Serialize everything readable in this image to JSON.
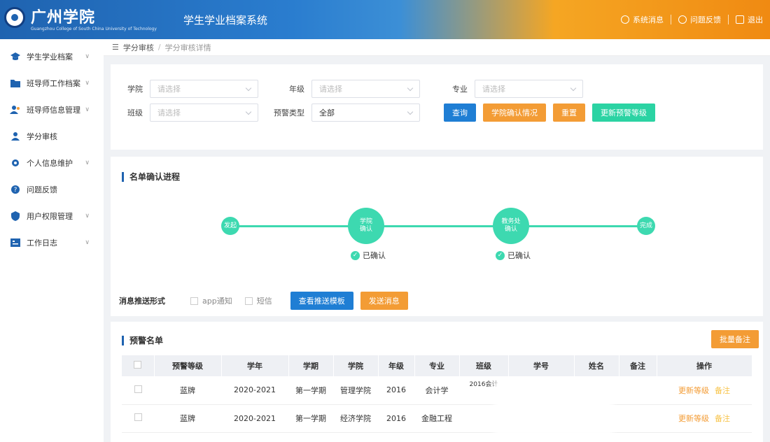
{
  "header": {
    "school_name": "广州学院",
    "school_name_en": "Guangzhou College of South China University of Technology",
    "system_title": "学生学业档案系统",
    "actions": [
      {
        "label": "系统消息",
        "icon": "bell-icon"
      },
      {
        "label": "问题反馈",
        "icon": "help-icon"
      },
      {
        "label": "退出",
        "icon": "logout-icon"
      }
    ]
  },
  "sidebar": {
    "items": [
      {
        "label": "学生学业档案",
        "icon": "graduation-icon",
        "color": "#1f63b0",
        "chevron": true
      },
      {
        "label": "班导师工作档案",
        "icon": "folder-icon",
        "color": "#1f63b0",
        "chevron": true
      },
      {
        "label": "班导师信息管理",
        "icon": "users-icon",
        "color": "#1f63b0",
        "chevron": true
      },
      {
        "label": "学分审核",
        "icon": "user-check-icon",
        "color": "#1f63b0",
        "chevron": false
      },
      {
        "label": "个人信息维护",
        "icon": "gear-icon",
        "color": "#1f63b0",
        "chevron": true
      },
      {
        "label": "问题反馈",
        "icon": "question-icon",
        "color": "#1f63b0",
        "chevron": false
      },
      {
        "label": "用户权限管理",
        "icon": "shield-icon",
        "color": "#1f63b0",
        "chevron": true
      },
      {
        "label": "工作日志",
        "icon": "log-icon",
        "color": "#1f63b0",
        "chevron": true
      }
    ]
  },
  "breadcrumb": {
    "root": "学分审核",
    "sep": "/",
    "current": "学分审核详情"
  },
  "filter": {
    "college_label": "学院",
    "college_placeholder": "请选择",
    "grade_label": "年级",
    "grade_placeholder": "请选择",
    "major_label": "专业",
    "major_placeholder": "请选择",
    "class_label": "班级",
    "class_placeholder": "请选择",
    "warn_type_label": "预警类型",
    "warn_type_value": "全部",
    "buttons": {
      "query": "查询",
      "confirm_status": "学院确认情况",
      "reset": "重置",
      "update_level": "更新预警等级"
    }
  },
  "progress": {
    "title": "名单确认进程",
    "nodes": [
      {
        "label": "发起"
      },
      {
        "label": "学院\n确认"
      },
      {
        "label": "教务处\n确认"
      },
      {
        "label": "完成"
      }
    ],
    "confirmed": "已确认",
    "push_label": "消息推送形式",
    "opt_app": "app通知",
    "opt_sms": "短信",
    "btn_template": "查看推送模板",
    "btn_send": "发送消息"
  },
  "warning": {
    "title": "预警名单",
    "batch_btn": "批量备注",
    "columns": [
      "预警等级",
      "学年",
      "学期",
      "学院",
      "年级",
      "专业",
      "班级",
      "学号",
      "姓名",
      "备注",
      "操作"
    ],
    "rows": [
      {
        "level": "蓝牌",
        "year": "2020-2021",
        "term": "第一学期",
        "college": "管理学院",
        "grade": "2016",
        "major": "会计学",
        "class": "2016会计",
        "op_update": "更新等级",
        "op_note": "备注"
      },
      {
        "level": "蓝牌",
        "year": "2020-2021",
        "term": "第一学期",
        "college": "经济学院",
        "grade": "2016",
        "major": "金融工程",
        "class": "",
        "op_update": "更新等级",
        "op_note": "备注"
      }
    ]
  }
}
